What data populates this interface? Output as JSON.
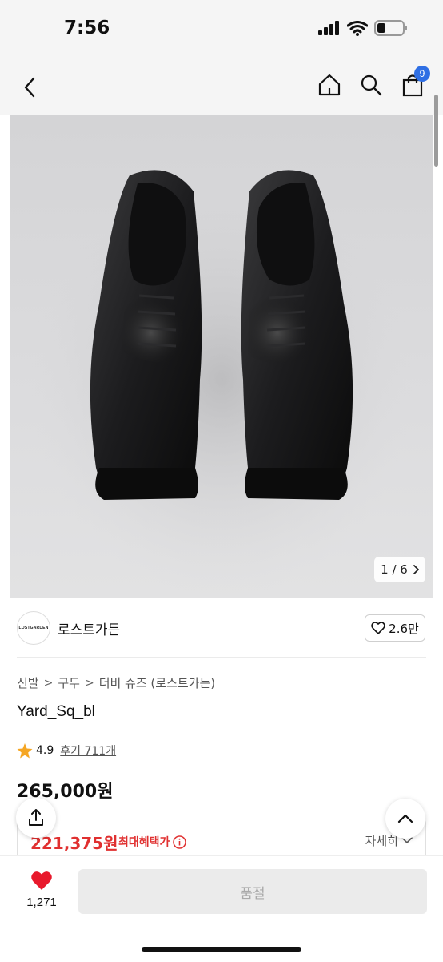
{
  "status": {
    "time": "7:56",
    "battery_percent": 25
  },
  "nav": {
    "cart_count": "9"
  },
  "image": {
    "counter": "1 / 6",
    "background": "#d8d8da"
  },
  "brand": {
    "logo_text": "LOSTGARDEN",
    "name": "로스트가든",
    "likes": "2.6만"
  },
  "breadcrumb": [
    "신발",
    "구두",
    "더비 슈즈 (로스트가든)"
  ],
  "product": {
    "name": "Yard_Sq_bl",
    "rating": "4.9",
    "reviews": "후기 711개",
    "price": "265,000원"
  },
  "benefit": {
    "price": "221,375원",
    "label": "최대혜택가",
    "detail": "자세히"
  },
  "bottom": {
    "wish_count": "1,271",
    "buy_label": "품절"
  },
  "colors": {
    "accent_red": "#e03030",
    "badge_blue": "#2f6fe4",
    "heart_red": "#e8192c"
  }
}
